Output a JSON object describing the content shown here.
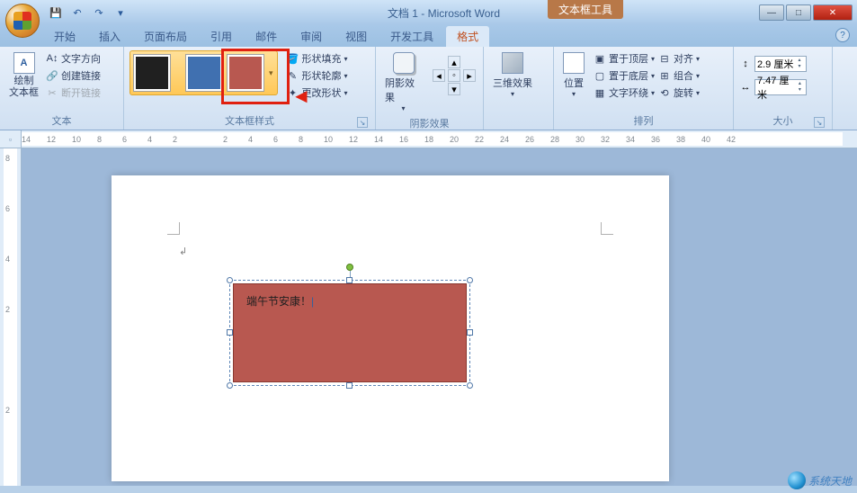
{
  "title": "文档 1 - Microsoft Word",
  "tool_tab": "文本框工具",
  "qat": {
    "save": "💾",
    "undo": "↶",
    "redo": "↷",
    "more": "▾"
  },
  "win": {
    "min": "—",
    "max": "□",
    "close": "✕"
  },
  "tabs": [
    "开始",
    "插入",
    "页面布局",
    "引用",
    "邮件",
    "审阅",
    "视图",
    "开发工具",
    "格式"
  ],
  "active_tab": "格式",
  "help": "?",
  "groups": {
    "text": {
      "label": "文本",
      "draw_textbox": "绘制\n文本框",
      "text_direction": "文字方向",
      "create_link": "创建链接",
      "break_link": "断开链接"
    },
    "styles": {
      "label": "文本框样式",
      "shape_fill": "形状填充",
      "shape_outline": "形状轮廓",
      "change_shape": "更改形状"
    },
    "shadow": {
      "label": "阴影效果",
      "btn": "阴影效果"
    },
    "three_d": {
      "label": "",
      "btn": "三维效果"
    },
    "arrange": {
      "label": "排列",
      "position": "位置",
      "bring_front": "置于顶层",
      "send_back": "置于底层",
      "text_wrap": "文字环绕",
      "align": "对齐",
      "group": "组合",
      "rotate": "旋转"
    },
    "size": {
      "label": "大小",
      "height": "2.9 厘米",
      "width": "7.47 厘米"
    }
  },
  "ruler_h": [
    "14",
    "12",
    "10",
    "8",
    "6",
    "4",
    "2",
    "",
    "2",
    "4",
    "6",
    "8",
    "10",
    "12",
    "14",
    "16",
    "18",
    "20",
    "22",
    "24",
    "26",
    "28",
    "30",
    "32",
    "34",
    "36",
    "38",
    "40",
    "42"
  ],
  "ruler_v": [
    "8",
    "6",
    "4",
    "2",
    "",
    "2"
  ],
  "textbox_text": "端午节安康！",
  "watermark": "系统天地"
}
